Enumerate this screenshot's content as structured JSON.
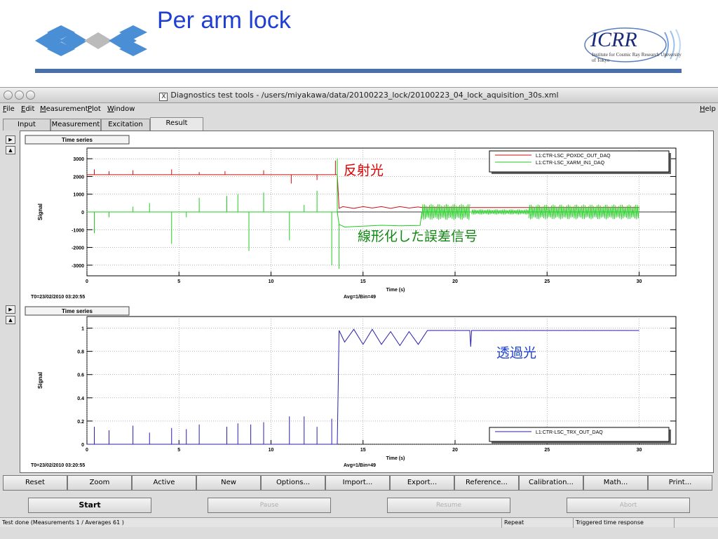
{
  "slide": {
    "title": "Per arm lock",
    "logo_text": "ICRR",
    "logo_subtitle": "Institute for Cosmic Ray Research University of Tokyo"
  },
  "window": {
    "title": "Diagnostics test tools - /users/miyakawa/data/20100223_lock/20100223_04_lock_aquisition_30s.xml"
  },
  "menu": [
    "File",
    "Edit",
    "Measurement",
    "Plot",
    "Window"
  ],
  "help": "Help",
  "tabs": [
    "Input",
    "Measurement",
    "Excitation",
    "Result"
  ],
  "active_tab": "Result",
  "buttons": [
    "Reset",
    "Zoom",
    "Active",
    "New",
    "Options...",
    "Import...",
    "Export...",
    "Reference...",
    "Calibration...",
    "Math...",
    "Print..."
  ],
  "run_buttons": {
    "start": "Start",
    "pause": "Pause",
    "resume": "Resume",
    "abort": "Abort"
  },
  "status": {
    "message": "Test done (Measurements 1 / Averages 61 )",
    "repeat": "Repeat",
    "mode": "Triggered time response"
  },
  "colors": {
    "red_trace": "#cc1111",
    "green_trace": "#22cc22",
    "blue_trace": "#2a1fb0",
    "annot_red": "#e00000",
    "annot_green": "#118811",
    "annot_blue": "#1a3fd0"
  },
  "chart_data": [
    {
      "type": "line",
      "panel_title": "Time series",
      "xlabel": "Time (s)",
      "ylabel": "Signal",
      "xlim": [
        0,
        32
      ],
      "ylim": [
        -3600,
        3600
      ],
      "xticks": [
        0,
        5,
        10,
        15,
        20,
        25,
        30
      ],
      "yticks": [
        -3000,
        -2000,
        -1000,
        0,
        1000,
        2000,
        3000
      ],
      "grid": true,
      "legend_position": "top-right",
      "footer_left": "T0=23/02/2010 03:20:55",
      "footer_center": "Avg=1/Bin=49",
      "annotations": [
        "反射光",
        "線形化した誤差信号"
      ],
      "series": [
        {
          "name": "L1:CTR-LSC_POXDC_OUT_DAQ",
          "color": "#cc1111",
          "x": [
            0,
            13.6,
            13.7,
            13.9,
            14.5,
            15,
            15.5,
            16,
            16.5,
            17,
            17.5,
            18,
            18.2,
            20.8,
            21,
            30
          ],
          "y": [
            2100,
            2100,
            200,
            300,
            200,
            300,
            220,
            300,
            200,
            300,
            220,
            280,
            250,
            250,
            250,
            250
          ],
          "spikes": [
            {
              "x": 0.4,
              "y": 2400
            },
            {
              "x": 1.2,
              "y": 2300
            },
            {
              "x": 2.5,
              "y": 2350
            },
            {
              "x": 4.6,
              "y": 2400
            },
            {
              "x": 6.1,
              "y": 2250
            },
            {
              "x": 7.5,
              "y": 2300
            },
            {
              "x": 9.6,
              "y": 2350
            },
            {
              "x": 11.1,
              "y": 1600
            },
            {
              "x": 12.5,
              "y": 1800
            },
            {
              "x": 13.5,
              "y": 2900
            }
          ]
        },
        {
          "name": "L1:CTR-LSC_XARM_IN1_DAQ",
          "color": "#22cc22",
          "x": [
            0,
            13.6,
            13.7,
            14,
            15,
            16,
            17,
            18.1,
            18.2,
            21,
            22,
            23,
            24,
            25,
            26,
            27,
            28,
            29,
            30
          ],
          "y": [
            0,
            0,
            -700,
            -850,
            -800,
            -750,
            -780,
            -760,
            0,
            0,
            0,
            0,
            0,
            0,
            0,
            0,
            0,
            0,
            0
          ],
          "spikes": [
            {
              "x": 0.4,
              "y": -1200
            },
            {
              "x": 1.2,
              "y": -300
            },
            {
              "x": 2.5,
              "y": 300
            },
            {
              "x": 3.4,
              "y": 500
            },
            {
              "x": 4.6,
              "y": -1800
            },
            {
              "x": 5.4,
              "y": -300
            },
            {
              "x": 6.1,
              "y": 800
            },
            {
              "x": 7.6,
              "y": 900
            },
            {
              "x": 8.2,
              "y": 1000
            },
            {
              "x": 8.8,
              "y": -2200
            },
            {
              "x": 9.6,
              "y": 1100
            },
            {
              "x": 11.0,
              "y": -1600
            },
            {
              "x": 11.8,
              "y": 400
            },
            {
              "x": 12.5,
              "y": 1200
            },
            {
              "x": 13.3,
              "y": -3000
            },
            {
              "x": 13.6,
              "y": 3000
            },
            {
              "x": 13.7,
              "y": -3200
            }
          ],
          "noise_bands": [
            {
              "x0": 18.2,
              "x1": 20.8,
              "amp": 450
            },
            {
              "x0": 20.9,
              "x1": 24.0,
              "amp": 150
            },
            {
              "x0": 24.0,
              "x1": 30.0,
              "amp": 420
            }
          ]
        }
      ]
    },
    {
      "type": "line",
      "panel_title": "Time series",
      "xlabel": "Time (s)",
      "ylabel": "Signal",
      "xlim": [
        0,
        32
      ],
      "ylim": [
        0,
        1.1
      ],
      "xticks": [
        0,
        5,
        10,
        15,
        20,
        25,
        30
      ],
      "yticks": [
        0,
        0.2,
        0.4,
        0.6,
        0.8,
        1
      ],
      "grid": true,
      "legend_position": "bottom-right",
      "footer_left": "T0=23/02/2010 03:20:55",
      "footer_center": "Avg=1/Bin=49",
      "annotations": [
        "透過光"
      ],
      "series": [
        {
          "name": "L1:CTR-LSC_TRX_OUT_DAQ",
          "color": "#2a1fb0",
          "x": [
            0,
            13.6,
            13.7,
            14.0,
            14.5,
            15.0,
            15.5,
            16.0,
            16.5,
            17.0,
            17.5,
            18.0,
            18.5,
            20.8,
            20.85,
            20.9,
            30
          ],
          "y": [
            0,
            0,
            0.98,
            0.88,
            0.99,
            0.86,
            0.99,
            0.86,
            0.97,
            0.85,
            0.97,
            0.86,
            0.98,
            0.98,
            0.84,
            0.98,
            0.98
          ],
          "spikes": [
            {
              "x": 0.4,
              "y": 0.15
            },
            {
              "x": 1.2,
              "y": 0.12
            },
            {
              "x": 2.5,
              "y": 0.16
            },
            {
              "x": 3.4,
              "y": 0.1
            },
            {
              "x": 4.6,
              "y": 0.14
            },
            {
              "x": 5.4,
              "y": 0.13
            },
            {
              "x": 6.1,
              "y": 0.17
            },
            {
              "x": 7.6,
              "y": 0.15
            },
            {
              "x": 8.2,
              "y": 0.18
            },
            {
              "x": 8.9,
              "y": 0.17
            },
            {
              "x": 9.6,
              "y": 0.19
            },
            {
              "x": 11.0,
              "y": 0.24
            },
            {
              "x": 11.8,
              "y": 0.24
            },
            {
              "x": 12.5,
              "y": 0.15
            },
            {
              "x": 13.3,
              "y": 0.22
            }
          ]
        }
      ]
    }
  ]
}
